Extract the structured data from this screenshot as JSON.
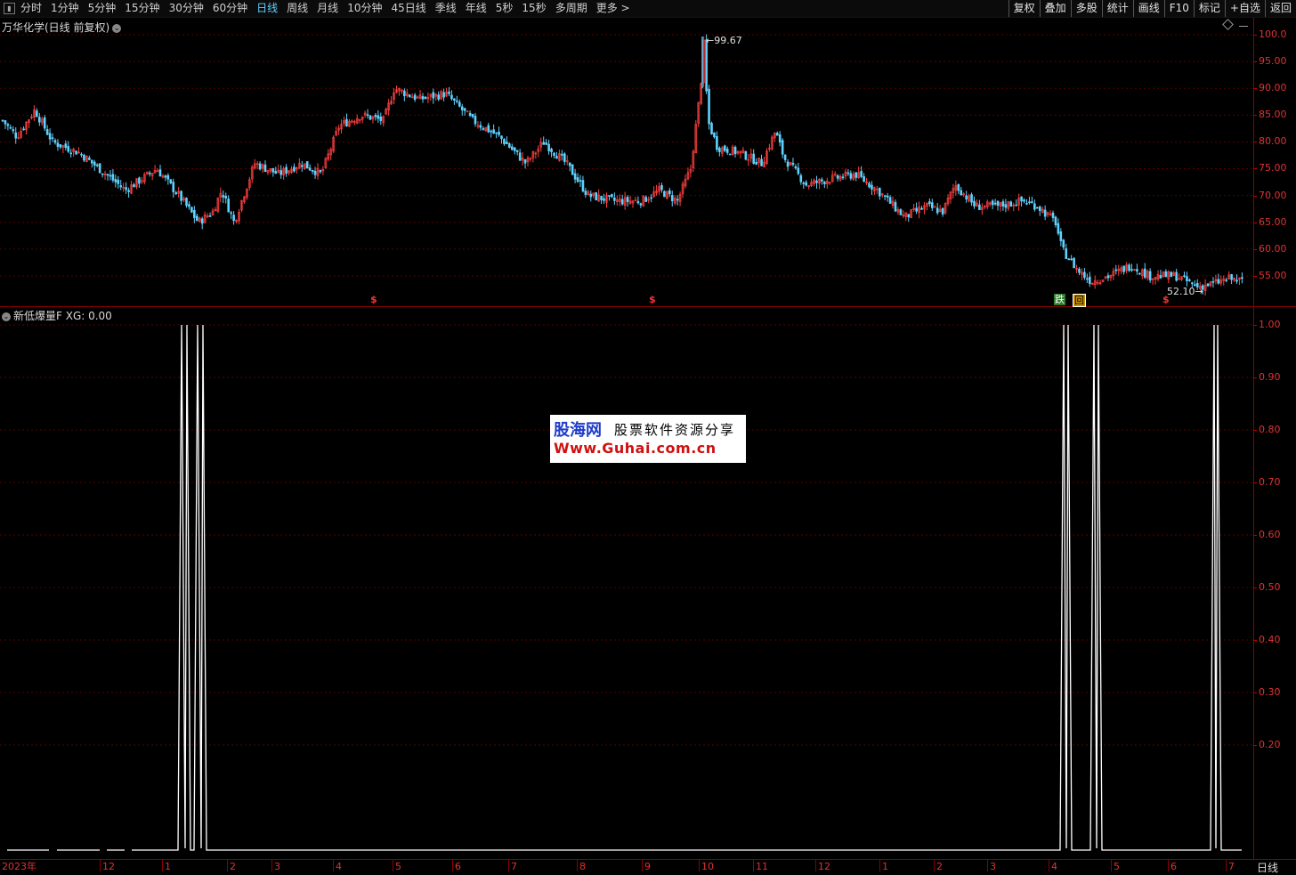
{
  "toolbar": {
    "periods": [
      "分时",
      "1分钟",
      "5分钟",
      "15分钟",
      "30分钟",
      "60分钟",
      "日线",
      "周线",
      "月线",
      "10分钟",
      "45日线",
      "季线",
      "年线",
      "5秒",
      "15秒",
      "多周期",
      "更多 >"
    ],
    "active_period": "日线",
    "right_buttons": [
      "复权",
      "叠加",
      "多股",
      "统计",
      "画线",
      "F10",
      "标记",
      "+自选",
      "返回"
    ]
  },
  "main_chart": {
    "title": "万华化学(日线 前复权)",
    "high_label": "99.67",
    "low_label": "52.10",
    "y_ticks": [
      "100.0",
      "95.00",
      "90.00",
      "85.00",
      "80.00",
      "75.00",
      "70.00",
      "65.00",
      "60.00",
      "55.00"
    ],
    "signal_marks": [
      "$",
      "$",
      "$"
    ],
    "badges": [
      {
        "text": "跌",
        "bg": "#2a7a2a",
        "color": "#ffffff"
      },
      {
        "text": "回",
        "bg": "#c89000",
        "color": "#000000"
      }
    ],
    "colors": {
      "up": "#ff4040",
      "down": "#5fd3ff"
    }
  },
  "indicator": {
    "title": "新低爆量F  XG: 0.00",
    "y_ticks": [
      "1.00",
      "0.90",
      "0.80",
      "0.70",
      "0.60",
      "0.50",
      "0.40",
      "0.30",
      "0.20"
    ]
  },
  "x_axis": {
    "labels": [
      "2023年",
      "12",
      "1",
      "2",
      "3",
      "4",
      "5",
      "6",
      "7",
      "8",
      "9",
      "10",
      "11",
      "12",
      "1",
      "2",
      "3",
      "4",
      "5",
      "6",
      "7"
    ]
  },
  "bottom_right": "日线",
  "watermark": {
    "logo": "股海网",
    "tagline": "股票软件资源分享",
    "url": "Www.Guhai.com.cn"
  }
}
